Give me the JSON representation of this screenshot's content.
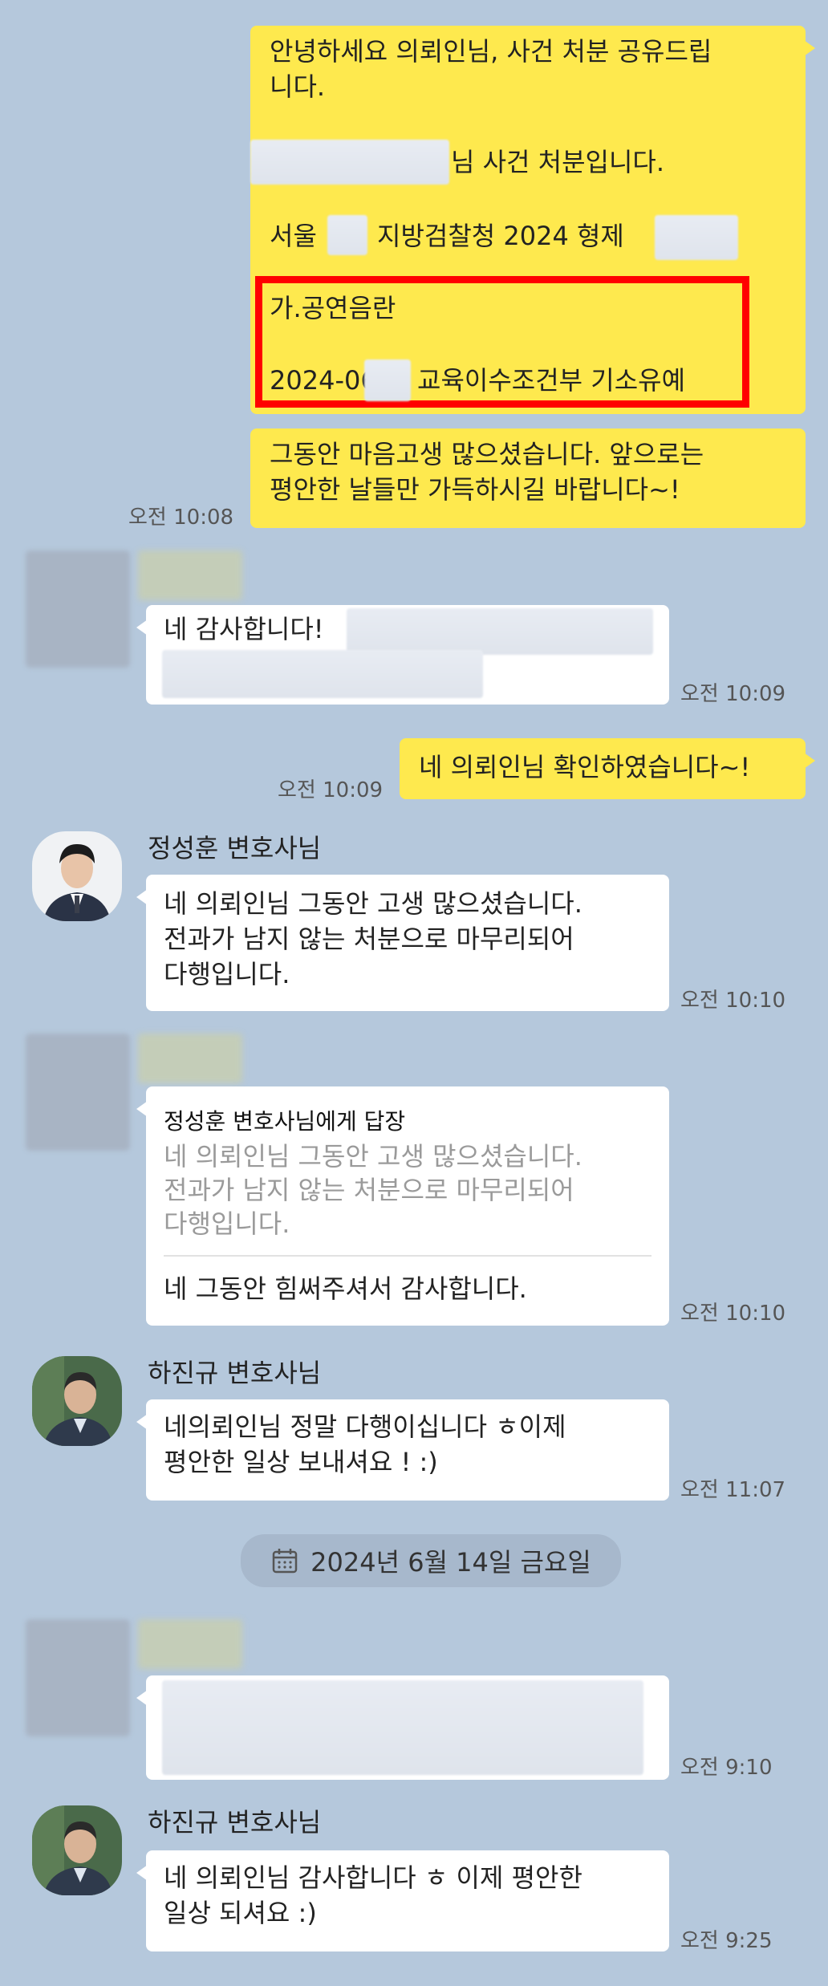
{
  "messages": {
    "m1": {
      "line1": "안녕하세요 의뢰인님, 사건 처분 공유드립",
      "line2": "니다.",
      "line3": "님 사건 처분입니다.",
      "line4a": "서울",
      "line4b": "지방검찰청 2024 형제",
      "line5": "가.공연음란",
      "line6a": "2024-06",
      "line6b": "교육이수조건부 기소유예"
    },
    "m2": {
      "text": "그동안 마음고생 많으셨습니다. 앞으로는\n평안한 날들만 가득하시길 바랍니다~!",
      "time": "오전 10:08"
    },
    "m3": {
      "text": "네 감사합니다!",
      "time": "오전 10:09"
    },
    "m4": {
      "text": "네 의뢰인님 확인하였습니다~!",
      "time": "오전 10:09"
    },
    "m5": {
      "sender": "정성훈 변호사님",
      "text": "네 의뢰인님 그동안 고생 많으셨습니다.\n전과가 남지 않는 처분으로 마무리되어\n다행입니다.",
      "time": "오전 10:10"
    },
    "m6": {
      "reply_to": "정성훈 변호사님에게 답장",
      "quote": "네 의뢰인님 그동안 고생 많으셨습니다.\n전과가 남지 않는 처분으로 마무리되어\n다행입니다.",
      "text": "네 그동안 힘써주셔서 감사합니다.",
      "time": "오전 10:10"
    },
    "m7": {
      "sender": "하진규 변호사님",
      "text": "네의뢰인님 정말 다행이십니다 ㅎ이제\n평안한 일상 보내셔요 ! :)",
      "time": "오전 11:07"
    },
    "date_divider": "2024년 6월 14일 금요일",
    "m8": {
      "time": "오전 9:10"
    },
    "m9": {
      "sender": "하진규 변호사님",
      "text": "네 의뢰인님 감사합니다 ㅎ 이제 평안한\n일상 되셔요 :)",
      "time": "오전 9:25"
    }
  },
  "icons": [
    "calendar-icon",
    "avatar-lawyer-1",
    "avatar-lawyer-2"
  ],
  "colors": {
    "background": "#b5c8dc",
    "my_bubble": "#fee94e",
    "their_bubble": "#ffffff",
    "highlight": "#ff0000"
  }
}
